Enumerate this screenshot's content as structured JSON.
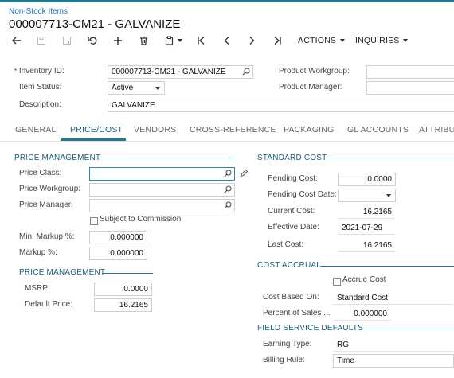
{
  "breadcrumb": "Non-Stock Items",
  "title": "000007713-CM21 - GALVANIZE",
  "toolbar": {
    "actions": "ACTIONS",
    "inquiries": "INQUIRIES",
    "icons": [
      "back-arrow-icon",
      "save-close-icon",
      "save-icon",
      "undo-icon",
      "add-icon",
      "delete-icon",
      "copy-paste-icon",
      "first-record-icon",
      "previous-record-icon",
      "next-record-icon",
      "last-record-icon"
    ]
  },
  "header": {
    "inventory_id_label": "Inventory ID:",
    "inventory_id": "000007713-CM21 - GALVANIZE",
    "item_status_label": "Item Status:",
    "item_status": "Active",
    "description_label": "Description:",
    "description": "GALVANIZE",
    "product_workgroup_label": "Product Workgroup:",
    "product_workgroup": "",
    "product_manager_label": "Product Manager:",
    "product_manager": ""
  },
  "tabs": [
    "GENERAL",
    "PRICE/COST",
    "VENDORS",
    "CROSS-REFERENCE",
    "PACKAGING",
    "GL ACCOUNTS",
    "ATTRIBUT"
  ],
  "active_tab": "PRICE/COST",
  "price_management": {
    "heading": "PRICE MANAGEMENT",
    "price_class_label": "Price Class:",
    "price_class": "",
    "price_workgroup_label": "Price Workgroup:",
    "price_workgroup": "",
    "price_manager_label": "Price Manager:",
    "price_manager": "",
    "subject_to_commission_label": "Subject to Commission",
    "subject_to_commission": false,
    "min_markup_label": "Min. Markup %:",
    "min_markup": "0.000000",
    "markup_label": "Markup %:",
    "markup": "0.000000"
  },
  "price_management_2": {
    "heading": "PRICE MANAGEMENT",
    "msrp_label": "MSRP:",
    "msrp": "0.0000",
    "default_price_label": "Default Price:",
    "default_price": "16.2165"
  },
  "standard_cost": {
    "heading": "STANDARD COST",
    "pending_cost_label": "Pending Cost:",
    "pending_cost": "0.0000",
    "pending_cost_date_label": "Pending Cost Date:",
    "pending_cost_date": "",
    "current_cost_label": "Current Cost:",
    "current_cost": "16.2165",
    "effective_date_label": "Effective Date:",
    "effective_date": "2021-07-29",
    "last_cost_label": "Last Cost:",
    "last_cost": "16.2165"
  },
  "cost_accrual": {
    "heading": "COST ACCRUAL",
    "accrue_cost_label": "Accrue Cost",
    "accrue_cost": false,
    "cost_based_on_label": "Cost Based On:",
    "cost_based_on": "Standard Cost",
    "percent_of_sales_label": "Percent of Sales ...",
    "percent_of_sales": "0.000000"
  },
  "field_service": {
    "heading": "FIELD SERVICE DEFAULTS",
    "earning_type_label": "Earning Type:",
    "earning_type": "RG",
    "billing_rule_label": "Billing Rule:",
    "billing_rule": "Time"
  },
  "colors": {
    "accent": "#1f7a8c",
    "link": "#1c6fb0",
    "section": "#1b5e7a"
  }
}
